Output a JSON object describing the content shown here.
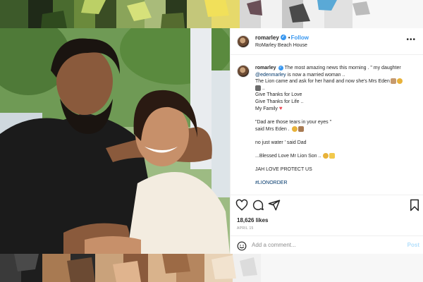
{
  "post": {
    "username": "romarley",
    "follow_label": "Follow",
    "location": "RoMarley Beach House",
    "more_label": "•••"
  },
  "caption": {
    "username": "romarley",
    "line1": "The most amazing news this morning . \" my daughter",
    "mention": "@edenmarley",
    "line2": " is now a married woman ..",
    "line3": "The Lion came and ask for her hand and now she's Mrs Eden",
    "line4": "Give Thanks for Love",
    "line5": "Give Thanks for Life ..",
    "line6": "My Family",
    "line7": "\"Dad are those tears in your eyes \"",
    "line8": "said Mrs Eden .",
    "line9": "no just water ' said Dad",
    "line10": "...Blessed Love Mr Lion Son ..",
    "line11": "JAH LOVE PROTECT US",
    "hashtag": "#LIONORDER"
  },
  "actions": {
    "like_icon": "heart-icon",
    "comment_icon": "comment-icon",
    "share_icon": "share-icon",
    "save_icon": "bookmark-icon",
    "likes": "18,626 likes",
    "date": "APRIL 15"
  },
  "comment": {
    "placeholder": "Add a comment...",
    "post_label": "Post",
    "emoji_icon": "smile-icon"
  },
  "colors": {
    "accent": "#3897f0",
    "heart": "#ed4956",
    "link": "#00376b",
    "post_disabled": "#b2dffc"
  }
}
